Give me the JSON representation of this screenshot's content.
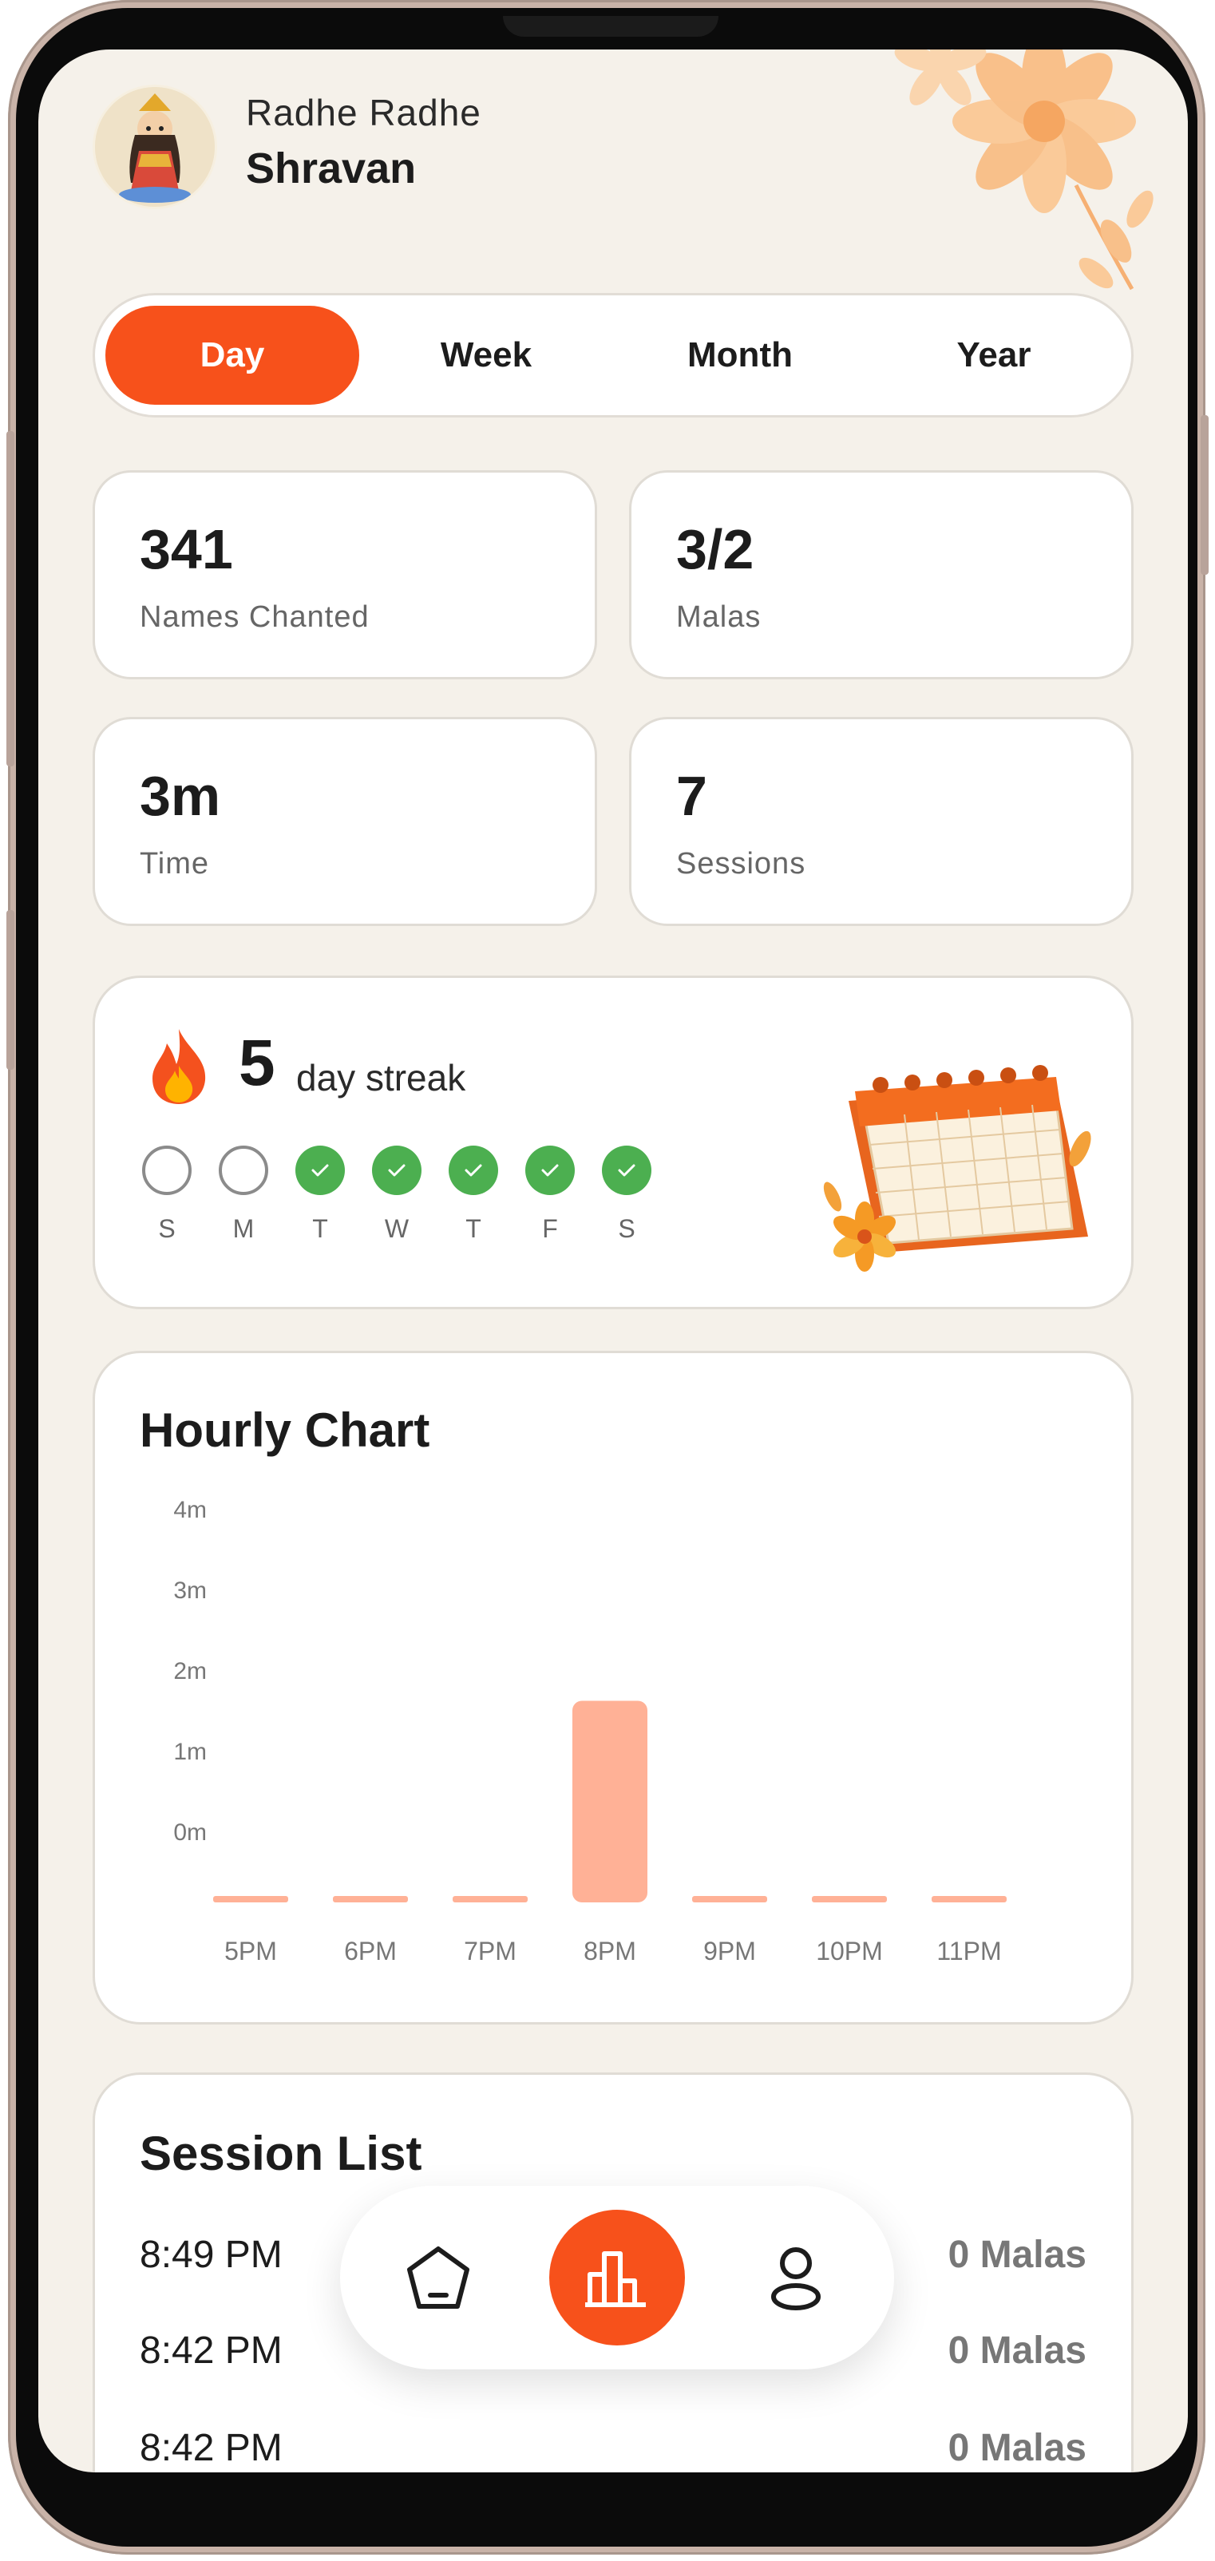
{
  "header": {
    "greeting": "Radhe Radhe",
    "username": "Shravan"
  },
  "tabs": [
    {
      "label": "Day",
      "active": true
    },
    {
      "label": "Week",
      "active": false
    },
    {
      "label": "Month",
      "active": false
    },
    {
      "label": "Year",
      "active": false
    }
  ],
  "stats": [
    {
      "value": "341",
      "label": "Names Chanted"
    },
    {
      "value": "3/2",
      "label": "Malas"
    },
    {
      "value": "3m",
      "label": "Time"
    },
    {
      "value": "7",
      "label": "Sessions"
    }
  ],
  "streak": {
    "count": "5",
    "label": "day streak",
    "days": [
      {
        "letter": "S",
        "done": false
      },
      {
        "letter": "M",
        "done": false
      },
      {
        "letter": "T",
        "done": true
      },
      {
        "letter": "W",
        "done": true
      },
      {
        "letter": "T",
        "done": true
      },
      {
        "letter": "F",
        "done": true
      },
      {
        "letter": "S",
        "done": true
      }
    ]
  },
  "hourly_chart": {
    "title": "Hourly Chart"
  },
  "chart_data": {
    "type": "bar",
    "title": "Hourly Chart",
    "categories": [
      "5PM",
      "6PM",
      "7PM",
      "8PM",
      "9PM",
      "10PM",
      "11PM"
    ],
    "values": [
      0,
      0,
      0,
      2.5,
      0,
      0,
      0
    ],
    "y_ticks": [
      "0m",
      "1m",
      "2m",
      "3m",
      "4m"
    ],
    "ylim": [
      0,
      4
    ],
    "xlabel": "",
    "ylabel": "",
    "grid": false,
    "bar_color": "#ffb196"
  },
  "session_list": {
    "title": "Session List",
    "items": [
      {
        "time": "8:49 PM",
        "malas": "0 Malas"
      },
      {
        "time": "8:42 PM",
        "malas": "0 Malas"
      },
      {
        "time": "8:42 PM",
        "malas": "0 Malas"
      }
    ]
  },
  "bottom_nav": [
    {
      "icon": "home-icon",
      "active": false
    },
    {
      "icon": "stats-chart-icon",
      "active": true
    },
    {
      "icon": "profile-icon",
      "active": false
    }
  ],
  "colors": {
    "accent": "#f7511b",
    "background": "#f5f1ea",
    "success": "#4caf50",
    "bar": "#ffb196"
  }
}
